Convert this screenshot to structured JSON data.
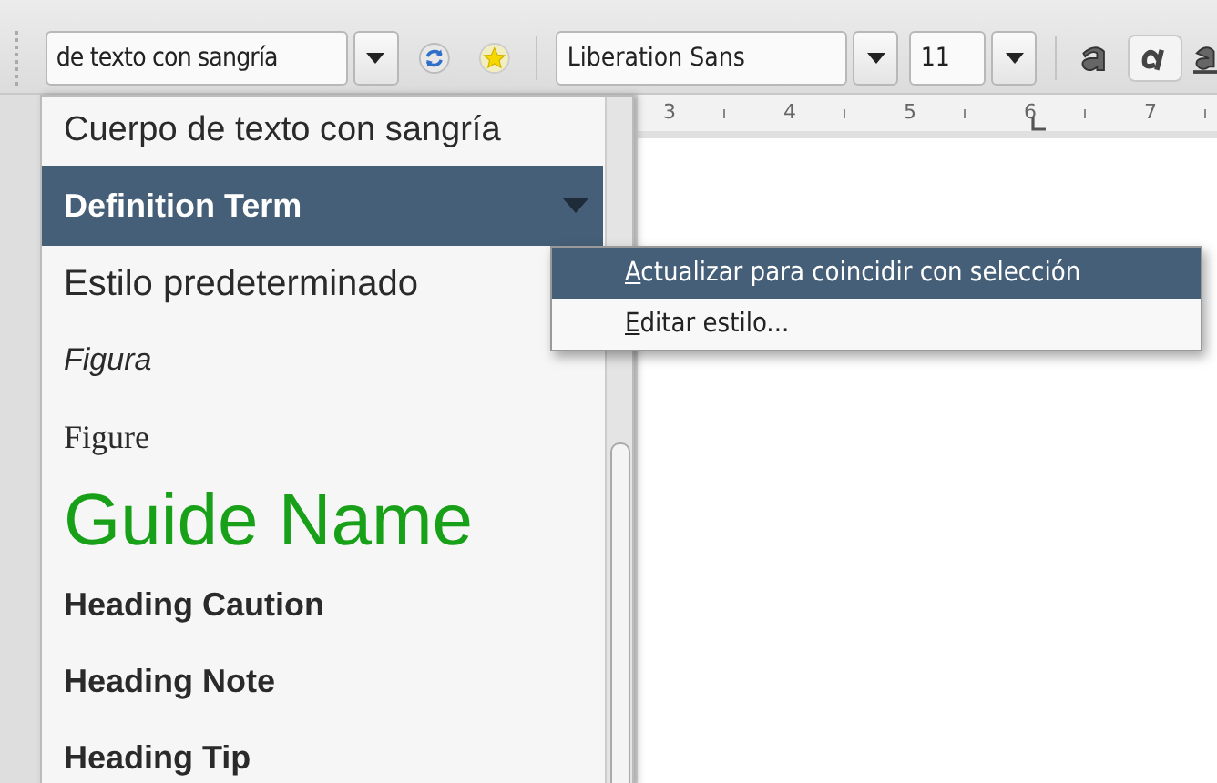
{
  "toolbar": {
    "style_box": {
      "value": "de texto con sangría"
    },
    "font_box": {
      "value": "Liberation Sans"
    },
    "size_box": {
      "value": "11"
    }
  },
  "ruler": {
    "labels": [
      "3",
      "4",
      "5",
      "6",
      "7"
    ]
  },
  "style_list": {
    "items": [
      {
        "label": "Cuerpo de texto con sangría",
        "kind": "plain",
        "selected": false
      },
      {
        "label": "Definition Term",
        "kind": "bold",
        "selected": true
      },
      {
        "label": "Estilo predeterminado",
        "kind": "large",
        "selected": false
      },
      {
        "label": "Figura",
        "kind": "italic",
        "selected": false
      },
      {
        "label": "Figure",
        "kind": "serif",
        "selected": false
      },
      {
        "label": "Guide Name",
        "kind": "title",
        "color": "#18a018",
        "selected": false
      },
      {
        "label": "Heading Caution",
        "kind": "bold",
        "selected": false
      },
      {
        "label": "Heading Note",
        "kind": "bold",
        "selected": false
      },
      {
        "label": "Heading Tip",
        "kind": "bold",
        "selected": false
      }
    ]
  },
  "context_menu": {
    "items": [
      {
        "label": "Actualizar para coincidir con selección",
        "selected": true
      },
      {
        "label": "Editar estilo...",
        "selected": false
      }
    ]
  }
}
